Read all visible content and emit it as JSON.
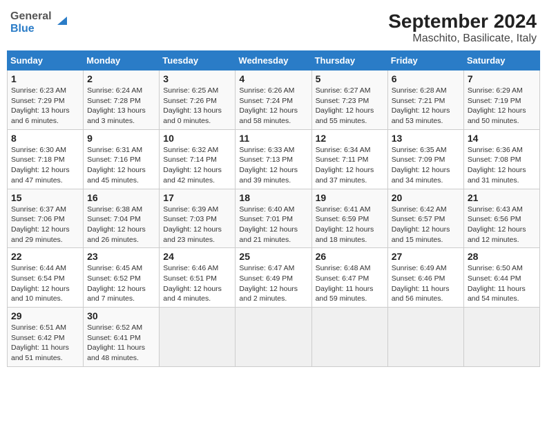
{
  "header": {
    "logo_line1": "General",
    "logo_line2": "Blue",
    "title": "September 2024",
    "subtitle": "Maschito, Basilicate, Italy"
  },
  "calendar": {
    "days_of_week": [
      "Sunday",
      "Monday",
      "Tuesday",
      "Wednesday",
      "Thursday",
      "Friday",
      "Saturday"
    ],
    "weeks": [
      [
        {
          "day": "1",
          "sunrise": "6:23 AM",
          "sunset": "7:29 PM",
          "daylight": "13 hours and 6 minutes."
        },
        {
          "day": "2",
          "sunrise": "6:24 AM",
          "sunset": "7:28 PM",
          "daylight": "13 hours and 3 minutes."
        },
        {
          "day": "3",
          "sunrise": "6:25 AM",
          "sunset": "7:26 PM",
          "daylight": "13 hours and 0 minutes."
        },
        {
          "day": "4",
          "sunrise": "6:26 AM",
          "sunset": "7:24 PM",
          "daylight": "12 hours and 58 minutes."
        },
        {
          "day": "5",
          "sunrise": "6:27 AM",
          "sunset": "7:23 PM",
          "daylight": "12 hours and 55 minutes."
        },
        {
          "day": "6",
          "sunrise": "6:28 AM",
          "sunset": "7:21 PM",
          "daylight": "12 hours and 53 minutes."
        },
        {
          "day": "7",
          "sunrise": "6:29 AM",
          "sunset": "7:19 PM",
          "daylight": "12 hours and 50 minutes."
        }
      ],
      [
        {
          "day": "8",
          "sunrise": "6:30 AM",
          "sunset": "7:18 PM",
          "daylight": "12 hours and 47 minutes."
        },
        {
          "day": "9",
          "sunrise": "6:31 AM",
          "sunset": "7:16 PM",
          "daylight": "12 hours and 45 minutes."
        },
        {
          "day": "10",
          "sunrise": "6:32 AM",
          "sunset": "7:14 PM",
          "daylight": "12 hours and 42 minutes."
        },
        {
          "day": "11",
          "sunrise": "6:33 AM",
          "sunset": "7:13 PM",
          "daylight": "12 hours and 39 minutes."
        },
        {
          "day": "12",
          "sunrise": "6:34 AM",
          "sunset": "7:11 PM",
          "daylight": "12 hours and 37 minutes."
        },
        {
          "day": "13",
          "sunrise": "6:35 AM",
          "sunset": "7:09 PM",
          "daylight": "12 hours and 34 minutes."
        },
        {
          "day": "14",
          "sunrise": "6:36 AM",
          "sunset": "7:08 PM",
          "daylight": "12 hours and 31 minutes."
        }
      ],
      [
        {
          "day": "15",
          "sunrise": "6:37 AM",
          "sunset": "7:06 PM",
          "daylight": "12 hours and 29 minutes."
        },
        {
          "day": "16",
          "sunrise": "6:38 AM",
          "sunset": "7:04 PM",
          "daylight": "12 hours and 26 minutes."
        },
        {
          "day": "17",
          "sunrise": "6:39 AM",
          "sunset": "7:03 PM",
          "daylight": "12 hours and 23 minutes."
        },
        {
          "day": "18",
          "sunrise": "6:40 AM",
          "sunset": "7:01 PM",
          "daylight": "12 hours and 21 minutes."
        },
        {
          "day": "19",
          "sunrise": "6:41 AM",
          "sunset": "6:59 PM",
          "daylight": "12 hours and 18 minutes."
        },
        {
          "day": "20",
          "sunrise": "6:42 AM",
          "sunset": "6:57 PM",
          "daylight": "12 hours and 15 minutes."
        },
        {
          "day": "21",
          "sunrise": "6:43 AM",
          "sunset": "6:56 PM",
          "daylight": "12 hours and 12 minutes."
        }
      ],
      [
        {
          "day": "22",
          "sunrise": "6:44 AM",
          "sunset": "6:54 PM",
          "daylight": "12 hours and 10 minutes."
        },
        {
          "day": "23",
          "sunrise": "6:45 AM",
          "sunset": "6:52 PM",
          "daylight": "12 hours and 7 minutes."
        },
        {
          "day": "24",
          "sunrise": "6:46 AM",
          "sunset": "6:51 PM",
          "daylight": "12 hours and 4 minutes."
        },
        {
          "day": "25",
          "sunrise": "6:47 AM",
          "sunset": "6:49 PM",
          "daylight": "12 hours and 2 minutes."
        },
        {
          "day": "26",
          "sunrise": "6:48 AM",
          "sunset": "6:47 PM",
          "daylight": "11 hours and 59 minutes."
        },
        {
          "day": "27",
          "sunrise": "6:49 AM",
          "sunset": "6:46 PM",
          "daylight": "11 hours and 56 minutes."
        },
        {
          "day": "28",
          "sunrise": "6:50 AM",
          "sunset": "6:44 PM",
          "daylight": "11 hours and 54 minutes."
        }
      ],
      [
        {
          "day": "29",
          "sunrise": "6:51 AM",
          "sunset": "6:42 PM",
          "daylight": "11 hours and 51 minutes."
        },
        {
          "day": "30",
          "sunrise": "6:52 AM",
          "sunset": "6:41 PM",
          "daylight": "11 hours and 48 minutes."
        },
        null,
        null,
        null,
        null,
        null
      ]
    ],
    "labels": {
      "sunrise": "Sunrise:",
      "sunset": "Sunset:",
      "daylight": "Daylight:"
    }
  }
}
